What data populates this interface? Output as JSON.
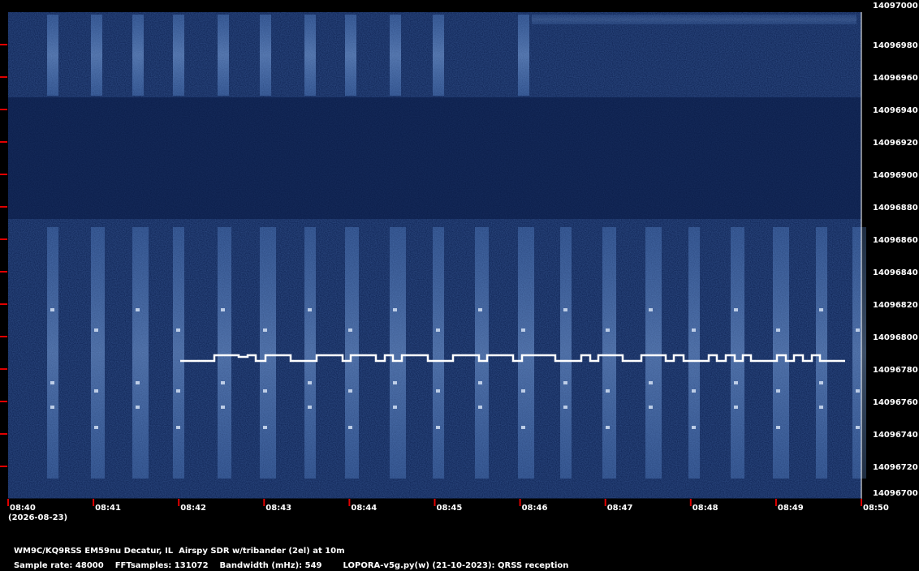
{
  "colors": {
    "background": "#000000",
    "plot_background": "#0b1f4e",
    "signal": "#9cc6ff",
    "trace": "#ffffff",
    "tick_marks": "#e00000",
    "text": "#ffffff"
  },
  "date_label": "(2026-08-23)",
  "footer": {
    "station": "WM9C/KQ9RSS EM59nu Decatur, IL  Airspy SDR w/tribander (2el) at 10m",
    "sample_rate": "Sample rate: 48000",
    "fft_samples": "FFTsamples: 131072",
    "bandwidth": "Bandwidth (mHz): 549",
    "software": "LOPORA-v5g.py(w) (21-10-2023): QRSS reception"
  },
  "chart_data": {
    "type": "heatmap",
    "x_tick_labels": [
      "08:40",
      "08:41",
      "08:42",
      "08:43",
      "08:44",
      "08:45",
      "08:46",
      "08:47",
      "08:48",
      "08:49",
      "08:50"
    ],
    "y_tick_labels": [
      "14097000",
      "14096980",
      "14096960",
      "14096940",
      "14096920",
      "14096900",
      "14096880",
      "14096860",
      "14096840",
      "14096820",
      "14096800",
      "14096780",
      "14096760",
      "14096740",
      "14096720",
      "14096700"
    ],
    "x_range": [
      "08:40",
      "08:50"
    ],
    "y_range": [
      14096700,
      14097000
    ]
  }
}
